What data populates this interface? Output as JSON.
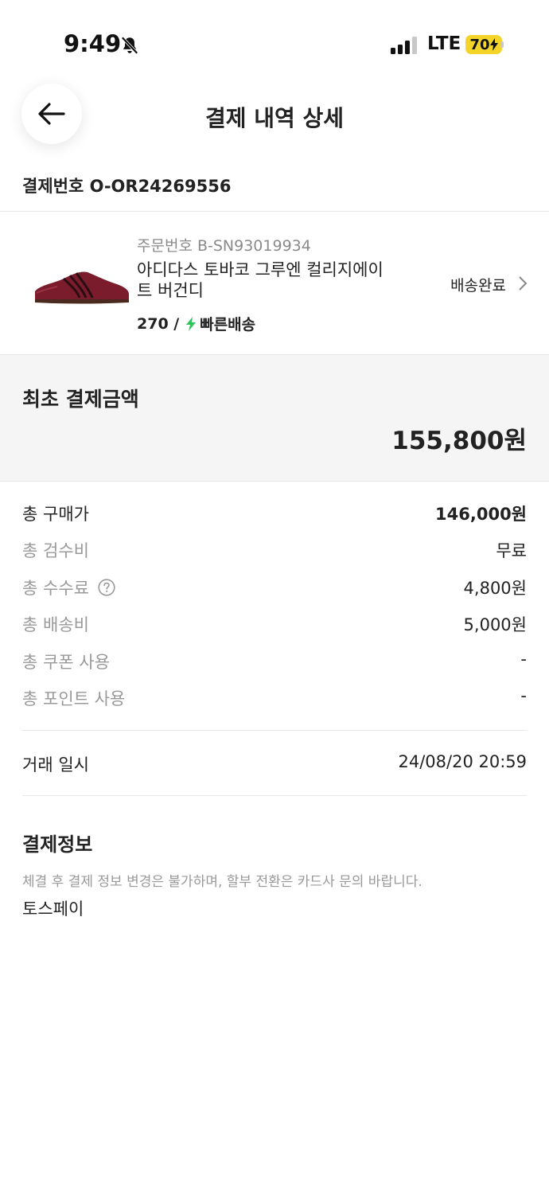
{
  "status_bar": {
    "time": "9:49",
    "network": "LTE",
    "battery": "70"
  },
  "header": {
    "title": "결제 내역 상세"
  },
  "payment": {
    "number_label": "결제번호 O-OR24269556"
  },
  "product": {
    "order_number": "주문번호 B-SN93019934",
    "name": "아디다스 토바코 그루엔 컬리지에이트 버건디",
    "size": "270 /",
    "shipping_type": "빠른배송",
    "status": "배송완료",
    "image_icon": "burgundy-sneaker"
  },
  "initial_payment": {
    "label": "최초 결제금액",
    "amount": "155,800원"
  },
  "breakdown": [
    {
      "label": "총 구매가",
      "value": "146,000원"
    },
    {
      "label": "총 검수비",
      "value": "무료"
    },
    {
      "label": "총 수수료",
      "value": "4,800원"
    },
    {
      "label": "총 배송비",
      "value": "5,000원"
    },
    {
      "label": "총 쿠폰 사용",
      "value": "-"
    },
    {
      "label": "총 포인트 사용",
      "value": "-"
    }
  ],
  "transaction": {
    "label": "거래 일시",
    "value": "24/08/20 20:59"
  },
  "payment_info": {
    "title": "결제정보",
    "note": "체결 후 결제 정보 변경은 불가하며, 할부 전환은 카드사 문의 바랍니다.",
    "method": "토스페이"
  },
  "colors": {
    "accent_bolt": "#2ec45a",
    "battery": "#f5d42a",
    "muted": "#999999"
  }
}
